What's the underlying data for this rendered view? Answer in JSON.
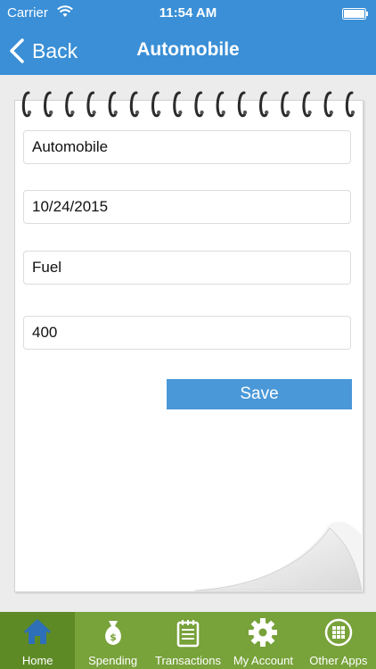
{
  "status_bar": {
    "carrier": "Carrier",
    "time": "11:54 AM"
  },
  "nav": {
    "back_label": "Back",
    "title": "Automobile"
  },
  "form": {
    "fields": [
      {
        "name": "category",
        "value": "Automobile"
      },
      {
        "name": "date",
        "value": "10/24/2015"
      },
      {
        "name": "subcategory",
        "value": "Fuel"
      },
      {
        "name": "amount",
        "value": "400"
      }
    ],
    "save_label": "Save"
  },
  "tabs": [
    {
      "label": "Home",
      "icon": "home-icon",
      "active": true
    },
    {
      "label": "Spending",
      "icon": "money-bag-icon",
      "active": false
    },
    {
      "label": "Transactions",
      "icon": "notepad-icon",
      "active": false
    },
    {
      "label": "My Account",
      "icon": "gear-icon",
      "active": false
    },
    {
      "label": "Other Apps",
      "icon": "grid-icon",
      "active": false
    }
  ],
  "colors": {
    "nav_blue": "#3a8fd6",
    "save_blue": "#4a98d8",
    "tab_green": "#78a23a",
    "tab_active_green": "#5e8a26"
  }
}
